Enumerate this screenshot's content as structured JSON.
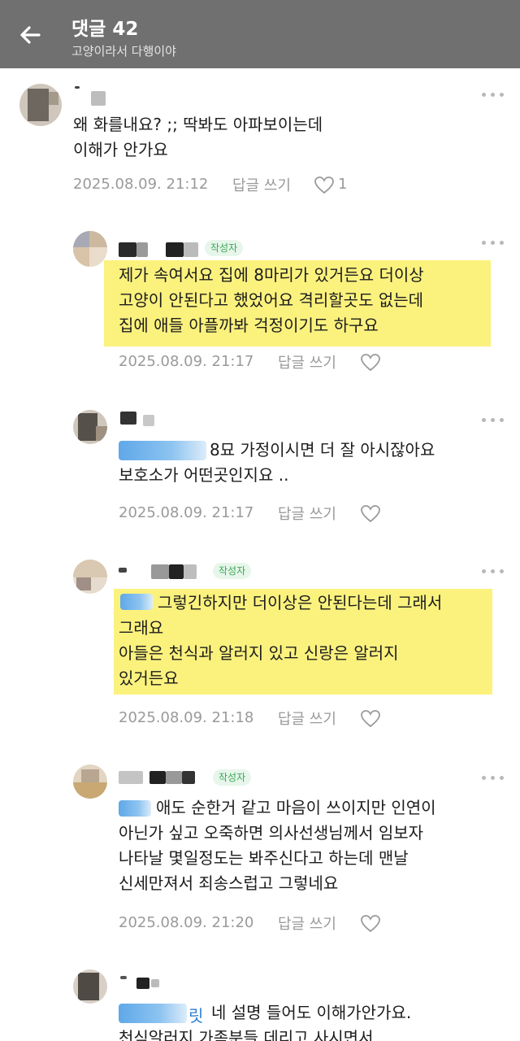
{
  "header": {
    "title": "댓글 42",
    "subtitle": "고양이라서 다행이야"
  },
  "comments": [
    {
      "lines": [
        "왜 화를내요? ;; 딱봐도 아파보이는데",
        "이해가 안가요"
      ],
      "date": "2025.08.09. 21:12",
      "reply_label": "답글 쓰기",
      "likes": "1"
    },
    {
      "badge": "작성자",
      "lines": [
        "제가 속여서요 집에 8마리가 있거든요 더이상",
        "고양이 안된다고 했었어요 격리할곳도 없는데",
        "집에 애들 아플까봐 걱정이기도 하구요"
      ],
      "date": "2025.08.09. 21:17",
      "reply_label": "답글 쓰기"
    },
    {
      "lines": [
        "8묘 가정이시면 더 잘 아시잖아요",
        "보호소가 어떤곳인지요 .."
      ],
      "date": "2025.08.09. 21:17",
      "reply_label": "답글 쓰기"
    },
    {
      "badge": "작성자",
      "lines": [
        "그렇긴하지만 더이상은 안된다는데 그래서",
        "그래요",
        "아들은 천식과 알러지 있고 신랑은 알러지",
        "있거든요"
      ],
      "date": "2025.08.09. 21:18",
      "reply_label": "답글 쓰기"
    },
    {
      "badge": "작성자",
      "lines": [
        "애도 순한거 같고 마음이 쓰이지만 인연이",
        "아닌가 싶고 오죽하면 의사선생님께서 임보자",
        "나타날 몇일정도는 봐주신다고 하는데 맨날",
        "신세만져서 죄송스럽고 그렇네요"
      ],
      "date": "2025.08.09. 21:20",
      "reply_label": "답글 쓰기"
    },
    {
      "mention_tail": "릿",
      "lines": [
        "네 설명 들어도 이해가안가요.",
        "천식알러지 가족분들 데리고 사시면서"
      ]
    }
  ]
}
